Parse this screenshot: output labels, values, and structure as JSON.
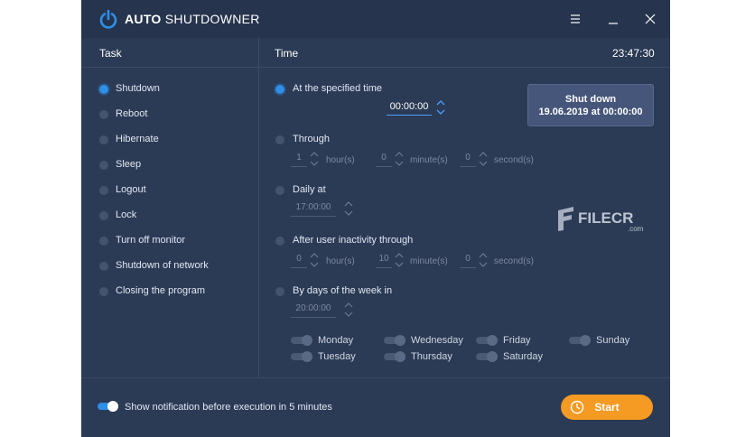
{
  "app": {
    "title_bold": "AUTO",
    "title_rest": " SHUTDOWNER"
  },
  "headers": {
    "task": "Task",
    "time": "Time",
    "clock": "23:47:30"
  },
  "tasks": [
    {
      "label": "Shutdown",
      "selected": true
    },
    {
      "label": "Reboot",
      "selected": false
    },
    {
      "label": "Hibernate",
      "selected": false
    },
    {
      "label": "Sleep",
      "selected": false
    },
    {
      "label": "Logout",
      "selected": false
    },
    {
      "label": "Lock",
      "selected": false
    },
    {
      "label": "Turn off monitor",
      "selected": false
    },
    {
      "label": "Shutdown of network",
      "selected": false
    },
    {
      "label": "Closing the program",
      "selected": false
    }
  ],
  "options": {
    "specified": {
      "label": "At the specified time",
      "value": "00:00:00",
      "selected": true
    },
    "through": {
      "label": "Through",
      "hours": "1",
      "hours_unit": "hour(s)",
      "minutes": "0",
      "minutes_unit": "minute(s)",
      "seconds": "0",
      "seconds_unit": "second(s)"
    },
    "daily": {
      "label": "Daily at",
      "value": "17:00:00"
    },
    "inactivity": {
      "label": "After user inactivity through",
      "hours": "0",
      "hours_unit": "hour(s)",
      "minutes": "10",
      "minutes_unit": "minute(s)",
      "seconds": "0",
      "seconds_unit": "second(s)"
    },
    "days": {
      "label": "By days of the week in",
      "value": "20:00:00"
    }
  },
  "weekdays": [
    "Monday",
    "Tuesday",
    "Wednesday",
    "Thursday",
    "Friday",
    "Saturday",
    "Sunday"
  ],
  "shutdown_box": {
    "line1": "Shut down",
    "line2": "19.06.2019 at 00:00:00"
  },
  "footer": {
    "notification": "Show notification before execution in 5 minutes",
    "start": "Start"
  },
  "watermark": {
    "text": "FILECR",
    "sub": ".com"
  },
  "colors": {
    "bg": "#2b3a55",
    "accent": "#2e8fe8",
    "start": "#f59a23"
  }
}
